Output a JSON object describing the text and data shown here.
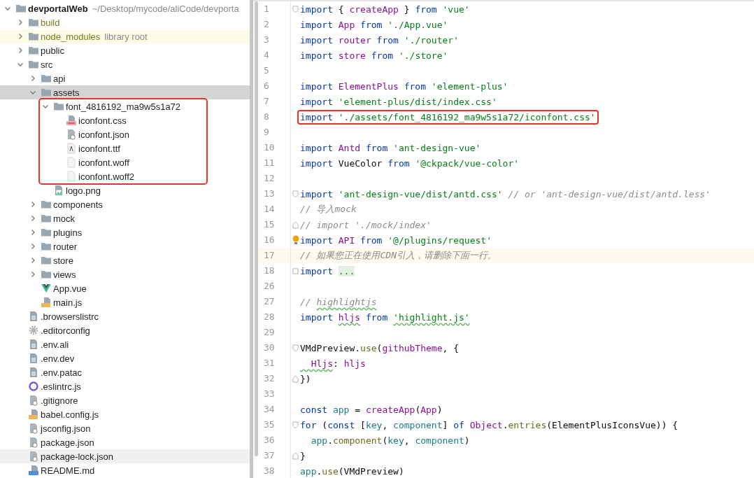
{
  "tree": {
    "label": "devportalWeb",
    "path": "~/Desktop/mycode/aliCode/devporta",
    "kind": "folder",
    "expanded": true,
    "excluded": false,
    "selected": false,
    "hovered": false,
    "children": [
      {
        "label": "build",
        "kind": "folder",
        "expanded": false,
        "excluded": true,
        "selected": false,
        "hovered": false
      },
      {
        "label": "node_modules",
        "note": "library root",
        "kind": "folder",
        "expanded": false,
        "excluded": true,
        "selected": false,
        "hovered": false
      },
      {
        "label": "public",
        "kind": "folder",
        "expanded": false,
        "excluded": false,
        "selected": false,
        "hovered": false
      },
      {
        "label": "src",
        "kind": "folder",
        "expanded": true,
        "excluded": false,
        "selected": false,
        "hovered": false,
        "children": [
          {
            "label": "api",
            "kind": "folder",
            "expanded": false,
            "excluded": false,
            "selected": false,
            "hovered": false
          },
          {
            "label": "assets",
            "kind": "folder",
            "expanded": true,
            "excluded": false,
            "selected": true,
            "hovered": false,
            "children": [
              {
                "label": "font_4816192_ma9w5s1a72",
                "kind": "folder",
                "expanded": true,
                "excluded": false,
                "selected": false,
                "hovered": false,
                "annotated": true,
                "children": [
                  {
                    "label": "iconfont.css",
                    "kind": "css",
                    "excluded": false,
                    "selected": false,
                    "hovered": false
                  },
                  {
                    "label": "iconfont.json",
                    "kind": "json",
                    "excluded": false,
                    "selected": false,
                    "hovered": false
                  },
                  {
                    "label": "iconfont.ttf",
                    "kind": "font",
                    "excluded": false,
                    "selected": false,
                    "hovered": false
                  },
                  {
                    "label": "iconfont.woff",
                    "kind": "blank",
                    "excluded": false,
                    "selected": false,
                    "hovered": false
                  },
                  {
                    "label": "iconfont.woff2",
                    "kind": "blank",
                    "excluded": false,
                    "selected": false,
                    "hovered": false
                  }
                ]
              },
              {
                "label": "logo.png",
                "kind": "image",
                "excluded": false,
                "selected": false,
                "hovered": false
              }
            ]
          },
          {
            "label": "components",
            "kind": "folder",
            "expanded": false,
            "excluded": false,
            "selected": false,
            "hovered": false
          },
          {
            "label": "mock",
            "kind": "folder",
            "expanded": false,
            "excluded": false,
            "selected": false,
            "hovered": false
          },
          {
            "label": "plugins",
            "kind": "folder",
            "expanded": false,
            "excluded": false,
            "selected": false,
            "hovered": false
          },
          {
            "label": "router",
            "kind": "folder",
            "expanded": false,
            "excluded": false,
            "selected": false,
            "hovered": false
          },
          {
            "label": "store",
            "kind": "folder",
            "expanded": false,
            "excluded": false,
            "selected": false,
            "hovered": false
          },
          {
            "label": "views",
            "kind": "folder",
            "expanded": false,
            "excluded": false,
            "selected": false,
            "hovered": false
          },
          {
            "label": "App.vue",
            "kind": "vue",
            "excluded": false,
            "selected": false,
            "hovered": false
          },
          {
            "label": "main.js",
            "kind": "js",
            "excluded": false,
            "selected": false,
            "hovered": false
          }
        ]
      },
      {
        "label": ".browserslistrc",
        "kind": "text",
        "excluded": false,
        "selected": false,
        "hovered": false
      },
      {
        "label": ".editorconfig",
        "kind": "gear",
        "excluded": false,
        "selected": false,
        "hovered": false
      },
      {
        "label": ".env.ali",
        "kind": "text",
        "excluded": false,
        "selected": false,
        "hovered": false
      },
      {
        "label": ".env.dev",
        "kind": "text",
        "excluded": false,
        "selected": false,
        "hovered": false
      },
      {
        "label": ".env.patac",
        "kind": "text",
        "excluded": false,
        "selected": false,
        "hovered": false
      },
      {
        "label": ".eslintrc.js",
        "kind": "eslint",
        "excluded": false,
        "selected": false,
        "hovered": false
      },
      {
        "label": ".gitignore",
        "kind": "gitignore",
        "excluded": false,
        "selected": false,
        "hovered": false
      },
      {
        "label": "babel.config.js",
        "kind": "js",
        "excluded": false,
        "selected": false,
        "hovered": false
      },
      {
        "label": "jsconfig.json",
        "kind": "json",
        "excluded": false,
        "selected": false,
        "hovered": false
      },
      {
        "label": "package.json",
        "kind": "json",
        "excluded": false,
        "selected": false,
        "hovered": false
      },
      {
        "label": "package-lock.json",
        "kind": "json",
        "excluded": false,
        "selected": false,
        "hovered": true
      },
      {
        "label": "README.md",
        "kind": "md",
        "excluded": false,
        "selected": false,
        "hovered": false
      }
    ]
  },
  "editor": {
    "lines": [
      {
        "number": "1",
        "fold_start": true,
        "current": false,
        "tokens": [
          {
            "kind": "kw",
            "t": "import"
          },
          {
            "kind": "plain",
            "t": " { "
          },
          {
            "kind": "id",
            "t": "createApp"
          },
          {
            "kind": "plain",
            "t": " } "
          },
          {
            "kind": "kw",
            "t": "from "
          },
          {
            "kind": "str",
            "t": "'vue'"
          }
        ]
      },
      {
        "number": "2",
        "current": false,
        "tokens": [
          {
            "kind": "kw",
            "t": "import "
          },
          {
            "kind": "id",
            "t": "App "
          },
          {
            "kind": "kw",
            "t": "from "
          },
          {
            "kind": "str",
            "t": "'./App.vue'"
          }
        ]
      },
      {
        "number": "3",
        "current": false,
        "tokens": [
          {
            "kind": "kw",
            "t": "import "
          },
          {
            "kind": "id",
            "t": "router "
          },
          {
            "kind": "kw",
            "t": "from "
          },
          {
            "kind": "str",
            "t": "'./router'"
          }
        ]
      },
      {
        "number": "4",
        "current": false,
        "tokens": [
          {
            "kind": "kw",
            "t": "import "
          },
          {
            "kind": "id",
            "t": "store "
          },
          {
            "kind": "kw",
            "t": "from "
          },
          {
            "kind": "str",
            "t": "'./store'"
          }
        ]
      },
      {
        "number": "5",
        "current": false
      },
      {
        "number": "6",
        "current": false,
        "tokens": [
          {
            "kind": "kw",
            "t": "import "
          },
          {
            "kind": "id",
            "t": "ElementPlus "
          },
          {
            "kind": "kw",
            "t": "from "
          },
          {
            "kind": "str",
            "t": "'element-plus'"
          }
        ]
      },
      {
        "number": "7",
        "current": false,
        "tokens": [
          {
            "kind": "kw",
            "t": "import "
          },
          {
            "kind": "str",
            "t": "'element-plus/dist/index.css'"
          }
        ]
      },
      {
        "number": "8",
        "current": false,
        "annotated": true,
        "tokens": [
          {
            "kind": "kw",
            "t": "import "
          },
          {
            "kind": "str",
            "t": "'./assets/font_4816192_ma9w5s1a72/iconfont.css'"
          }
        ]
      },
      {
        "number": "9",
        "current": false
      },
      {
        "number": "10",
        "current": false,
        "tokens": [
          {
            "kind": "kw",
            "t": "import "
          },
          {
            "kind": "id",
            "t": "Antd "
          },
          {
            "kind": "kw",
            "t": "from "
          },
          {
            "kind": "str",
            "t": "'ant-design-vue'"
          }
        ]
      },
      {
        "number": "11",
        "current": false,
        "tokens": [
          {
            "kind": "kw",
            "t": "import "
          },
          {
            "kind": "plain",
            "t": "VueColor "
          },
          {
            "kind": "kw",
            "t": "from "
          },
          {
            "kind": "str",
            "t": "'@ckpack/vue-color'"
          }
        ]
      },
      {
        "number": "12",
        "current": false
      },
      {
        "number": "13",
        "fold_start": true,
        "current": false,
        "tokens": [
          {
            "kind": "kw",
            "t": "import "
          },
          {
            "kind": "str",
            "t": "'ant-design-vue/dist/antd.css' "
          },
          {
            "kind": "cm",
            "t": "// or 'ant-design-vue/dist/antd.less'"
          }
        ]
      },
      {
        "number": "14",
        "current": false,
        "tokens": [
          {
            "kind": "cm",
            "t": "// 导入mock"
          }
        ]
      },
      {
        "number": "15",
        "fold_end": true,
        "current": false,
        "tokens": [
          {
            "kind": "cm",
            "t": "// import './mock/index'"
          }
        ]
      },
      {
        "number": "16",
        "current": false,
        "bulb": true,
        "tokens": [
          {
            "kind": "kw",
            "t": "import "
          },
          {
            "kind": "id",
            "t": "API "
          },
          {
            "kind": "kw",
            "t": "from "
          },
          {
            "kind": "str",
            "t": "'@/plugins/request'"
          }
        ]
      },
      {
        "number": "17",
        "current": true,
        "tokens": [
          {
            "kind": "cm",
            "t": "// 如果您正在使用CDN引入，请删除下面一行。"
          }
        ]
      },
      {
        "number": "18",
        "collapsed": true,
        "current": false,
        "tokens": [
          {
            "kind": "kw",
            "t": "import "
          },
          {
            "kind": "folded",
            "t": "..."
          }
        ]
      },
      {
        "number": "26",
        "current": false
      },
      {
        "number": "27",
        "current": false,
        "tokens": [
          {
            "kind": "cm",
            "t": "// "
          },
          {
            "kind": "cm",
            "t": "highlightjs",
            "typo": true
          }
        ]
      },
      {
        "number": "28",
        "current": false,
        "tokens": [
          {
            "kind": "kw",
            "t": "import "
          },
          {
            "kind": "id",
            "t": "hljs",
            "typo": true
          },
          {
            "kind": "kw",
            "t": " from "
          },
          {
            "kind": "str",
            "t": "'highlight.js'",
            "typo": true
          }
        ]
      },
      {
        "number": "29",
        "current": false
      },
      {
        "number": "30",
        "fold_start": true,
        "current": false,
        "tokens": [
          {
            "kind": "plain",
            "t": "VMdPreview."
          },
          {
            "kind": "fn",
            "t": "use"
          },
          {
            "kind": "plain",
            "t": "("
          },
          {
            "kind": "id",
            "t": "githubTheme"
          },
          {
            "kind": "plain",
            "t": ", {"
          }
        ]
      },
      {
        "number": "31",
        "current": false,
        "tokens": [
          {
            "kind": "id",
            "t": "  Hljs",
            "typo": true
          },
          {
            "kind": "plain",
            "t": ": "
          },
          {
            "kind": "id",
            "t": "hljs"
          }
        ]
      },
      {
        "number": "32",
        "fold_end": true,
        "current": false,
        "tokens": [
          {
            "kind": "plain",
            "t": "})"
          }
        ]
      },
      {
        "number": "33",
        "current": false
      },
      {
        "number": "34",
        "current": false,
        "tokens": [
          {
            "kind": "kw",
            "t": "const "
          },
          {
            "kind": "var",
            "t": "app"
          },
          {
            "kind": "plain",
            "t": " = "
          },
          {
            "kind": "id",
            "t": "createApp"
          },
          {
            "kind": "plain",
            "t": "("
          },
          {
            "kind": "id",
            "t": "App"
          },
          {
            "kind": "plain",
            "t": ")"
          }
        ]
      },
      {
        "number": "35",
        "fold_start": true,
        "current": false,
        "tokens": [
          {
            "kind": "kw",
            "t": "for"
          },
          {
            "kind": "plain",
            "t": " ("
          },
          {
            "kind": "kw",
            "t": "const"
          },
          {
            "kind": "plain",
            "t": " ["
          },
          {
            "kind": "var",
            "t": "key"
          },
          {
            "kind": "plain",
            "t": ", "
          },
          {
            "kind": "var",
            "t": "component"
          },
          {
            "kind": "plain",
            "t": "] "
          },
          {
            "kind": "kw",
            "t": "of "
          },
          {
            "kind": "id",
            "t": "Object"
          },
          {
            "kind": "plain",
            "t": "."
          },
          {
            "kind": "fn",
            "t": "entries"
          },
          {
            "kind": "plain",
            "t": "(ElementPlusIconsVue)) {"
          }
        ]
      },
      {
        "number": "36",
        "current": false,
        "tokens": [
          {
            "kind": "var",
            "t": "  app"
          },
          {
            "kind": "plain",
            "t": "."
          },
          {
            "kind": "fn",
            "t": "component"
          },
          {
            "kind": "plain",
            "t": "("
          },
          {
            "kind": "var",
            "t": "key"
          },
          {
            "kind": "plain",
            "t": ", "
          },
          {
            "kind": "var",
            "t": "component"
          },
          {
            "kind": "plain",
            "t": ")"
          }
        ]
      },
      {
        "number": "37",
        "fold_end": true,
        "current": false,
        "tokens": [
          {
            "kind": "plain",
            "t": "}"
          }
        ]
      },
      {
        "number": "38",
        "current": false,
        "tokens": [
          {
            "kind": "var",
            "t": "app"
          },
          {
            "kind": "plain",
            "t": "."
          },
          {
            "kind": "fn",
            "t": "use"
          },
          {
            "kind": "plain",
            "t": "(VMdPreview)"
          }
        ]
      }
    ]
  }
}
